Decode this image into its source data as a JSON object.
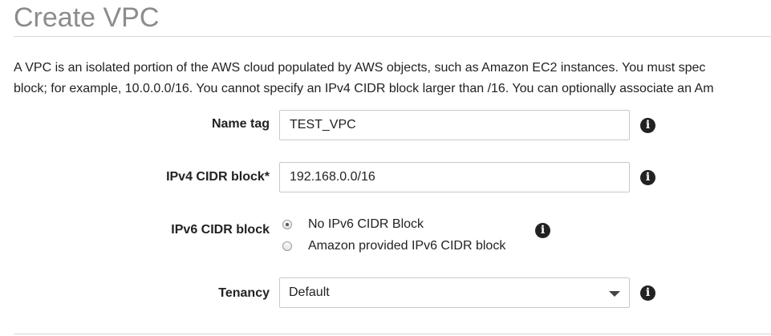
{
  "page": {
    "title": "Create VPC",
    "description_line1": "A VPC is an isolated portion of the AWS cloud populated by AWS objects, such as Amazon EC2 instances. You must spec",
    "description_line2": "block; for example, 10.0.0.0/16. You cannot specify an IPv4 CIDR block larger than /16. You can optionally associate an Am"
  },
  "form": {
    "name_tag": {
      "label": "Name tag",
      "value": "TEST_VPC",
      "info_icon": "info-icon"
    },
    "ipv4_cidr": {
      "label": "IPv4 CIDR block*",
      "value": "192.168.0.0/16",
      "info_icon": "info-icon"
    },
    "ipv6_cidr": {
      "label": "IPv6 CIDR block",
      "options": [
        {
          "label": "No IPv6 CIDR Block",
          "selected": true
        },
        {
          "label": "Amazon provided IPv6 CIDR block",
          "selected": false
        }
      ],
      "info_icon": "info-icon"
    },
    "tenancy": {
      "label": "Tenancy",
      "value": "Default",
      "info_icon": "info-icon"
    },
    "info_glyph": "i"
  }
}
